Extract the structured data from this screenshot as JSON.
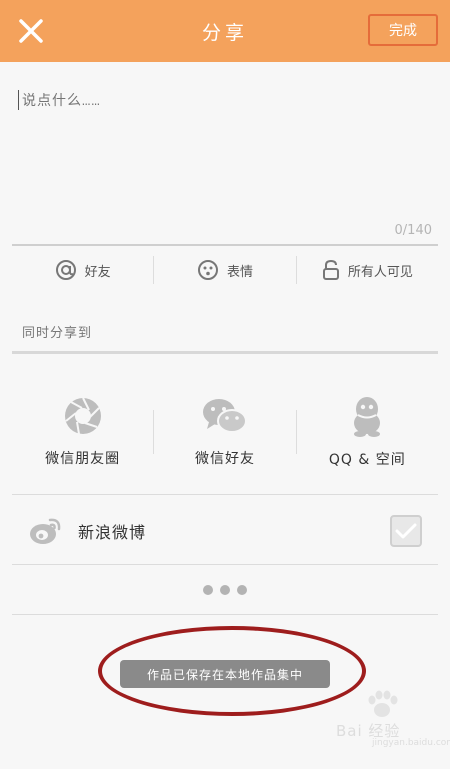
{
  "header": {
    "title": "分享",
    "done_label": "完成",
    "close_icon": "close-icon",
    "background": "#f4a25c"
  },
  "compose": {
    "placeholder": "说点什么……",
    "counter": "0/140"
  },
  "options": [
    {
      "icon": "at-icon",
      "label": "好友"
    },
    {
      "icon": "emoji-icon",
      "label": "表情"
    },
    {
      "icon": "lock-icon",
      "label": "所有人可见"
    }
  ],
  "share_to_label": "同时分享到",
  "platforms": [
    {
      "icon": "moments-icon",
      "label": "微信朋友圈"
    },
    {
      "icon": "wechat-icon",
      "label": "微信好友"
    },
    {
      "icon": "qq-icon",
      "label": "QQ & 空间"
    }
  ],
  "weibo": {
    "icon": "weibo-icon",
    "label": "新浪微博",
    "checked": true
  },
  "more_icon": "more-dots-icon",
  "toast": "作品已保存在本地作品集中",
  "annotation_color": "#9e1d1d",
  "watermark": {
    "main": "Bai 经验",
    "sub": "jingyan.baidu.com"
  }
}
